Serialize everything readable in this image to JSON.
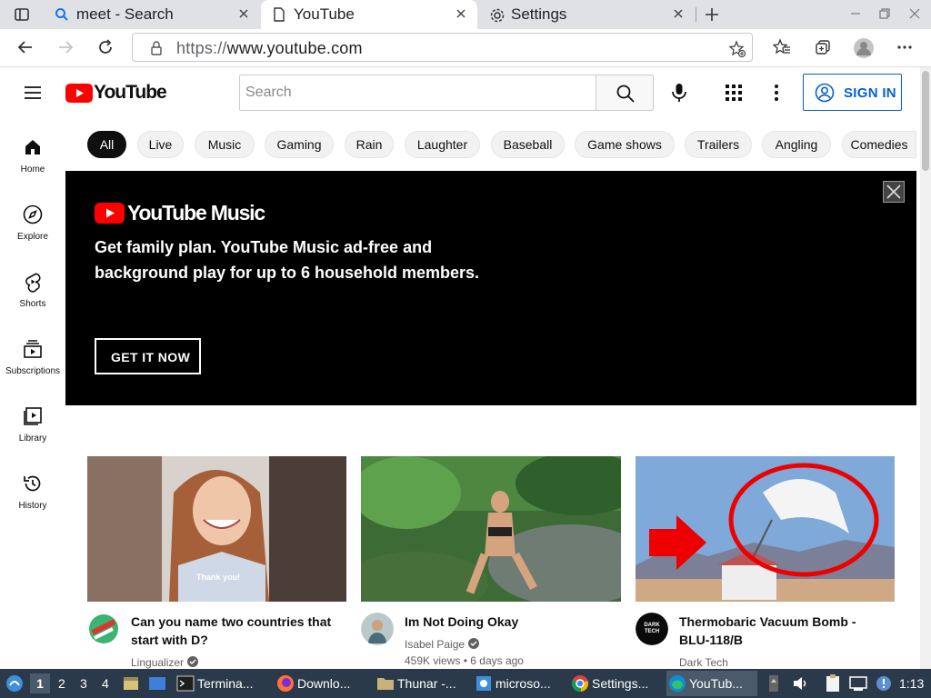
{
  "browser": {
    "tabs": [
      {
        "title": "meet - Search",
        "icon": "search-icon"
      },
      {
        "title": "YouTube",
        "icon": "page-icon",
        "active": true
      },
      {
        "title": "Settings",
        "icon": "gear-icon"
      }
    ],
    "url": {
      "scheme": "https://",
      "host": "www.youtube.com"
    }
  },
  "youtube": {
    "logo_text": "YouTube",
    "search_placeholder": "Search",
    "signin_label": "SIGN IN",
    "brand_color": "#ff0000",
    "accent_color": "#065fd4",
    "sidebar": [
      {
        "label": "Home",
        "icon": "home-icon"
      },
      {
        "label": "Explore",
        "icon": "compass-icon"
      },
      {
        "label": "Shorts",
        "icon": "shorts-icon"
      },
      {
        "label": "Subscriptions",
        "icon": "subscriptions-icon"
      },
      {
        "label": "Library",
        "icon": "library-icon"
      },
      {
        "label": "History",
        "icon": "history-icon"
      }
    ],
    "chips": [
      "All",
      "Live",
      "Music",
      "Gaming",
      "Rain",
      "Laughter",
      "Baseball",
      "Game shows",
      "Trailers",
      "Angling",
      "Comedies"
    ],
    "banner": {
      "logo_text": "YouTube Music",
      "message": "Get family plan. YouTube Music ad-free and background play for up to 6 household members.",
      "cta": "GET IT NOW"
    },
    "videos": [
      {
        "title": "Can you name two countries that start with D?",
        "channel": "Lingualizer",
        "verified": true,
        "caption": "Thank you!",
        "views": "",
        "age": ""
      },
      {
        "title": "Im Not Doing Okay",
        "channel": "Isabel Paige",
        "verified": true,
        "views": "459K views",
        "age": "6 days ago"
      },
      {
        "title": "Thermobaric Vacuum Bomb - BLU-118/B",
        "channel": "Dark Tech",
        "verified": false,
        "avatar_text": "DARK TECH",
        "views": "",
        "age": ""
      }
    ]
  },
  "taskbar": {
    "workspaces": [
      "1",
      "2",
      "3",
      "4"
    ],
    "apps": [
      {
        "label": "Termina...",
        "icon": "terminal-icon"
      },
      {
        "label": "Downlo...",
        "icon": "firefox-icon"
      },
      {
        "label": "Thunar -...",
        "icon": "folder-icon"
      },
      {
        "label": "microso...",
        "icon": "app-icon"
      },
      {
        "label": "Settings...",
        "icon": "chrome-icon"
      },
      {
        "label": "YouTub...",
        "icon": "edge-icon",
        "active": true
      }
    ],
    "clock": "1:13"
  }
}
